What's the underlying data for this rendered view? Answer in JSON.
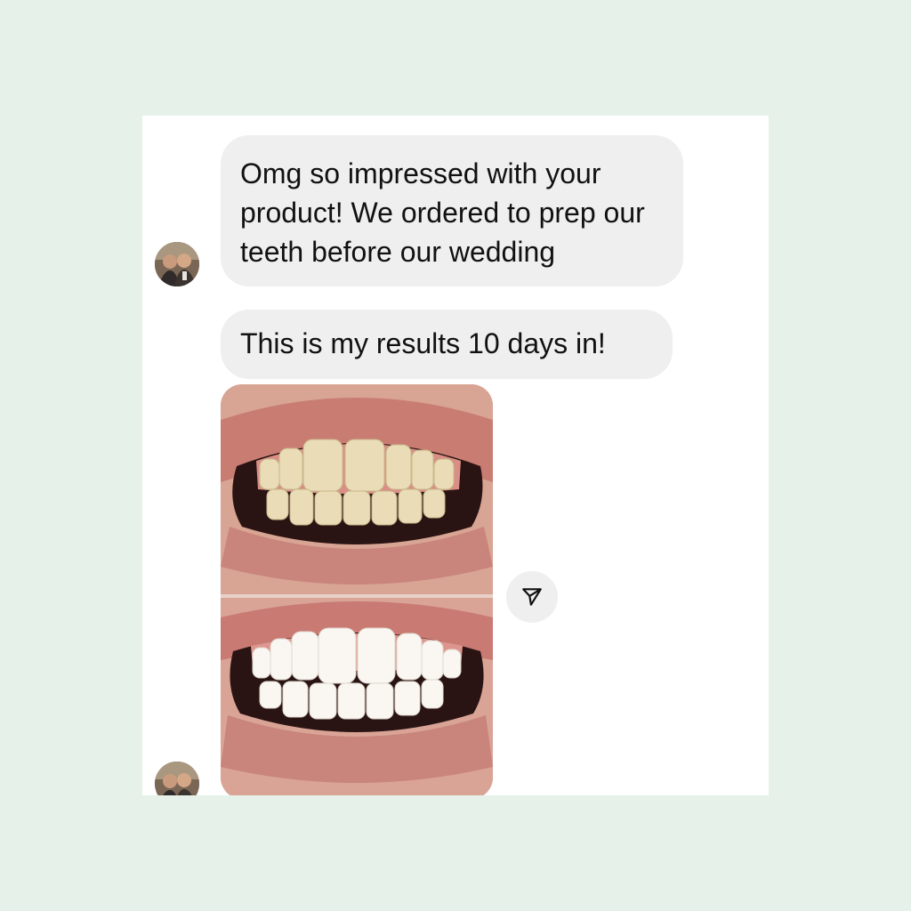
{
  "conversation": {
    "messages": [
      {
        "type": "text",
        "text": "Omg so impressed with your product! We ordered to prep our teeth before our wedding"
      },
      {
        "type": "text",
        "text": "This is my results 10 days in!"
      },
      {
        "type": "image",
        "description": "before-and-after-teeth-photo"
      }
    ],
    "share_icon": "send-icon"
  },
  "colors": {
    "page_background": "#e6f2e9",
    "card_background": "#ffffff",
    "bubble_background": "#efefef",
    "text": "#111111"
  }
}
